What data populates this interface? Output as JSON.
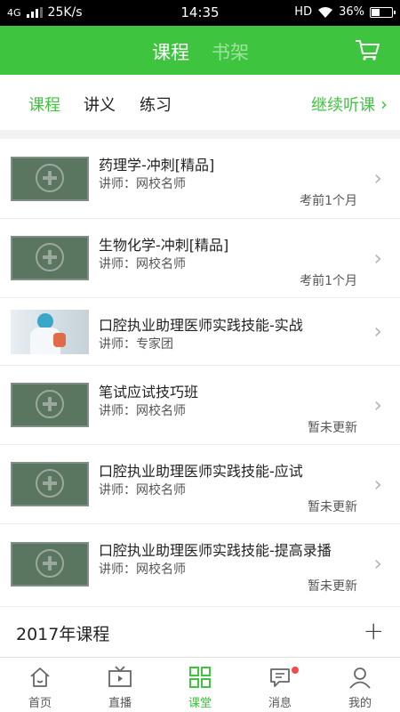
{
  "status_bar": {
    "network": "4G",
    "speed": "25K/s",
    "time": "14:35",
    "hd": "HD",
    "battery": "36%"
  },
  "header": {
    "tabs": [
      {
        "label": "课程"
      },
      {
        "label": "书架"
      }
    ]
  },
  "subtabs": {
    "items": [
      {
        "label": "课程"
      },
      {
        "label": "讲义"
      },
      {
        "label": "练习"
      }
    ],
    "continue_label": "继续听课"
  },
  "courses": [
    {
      "title": "药理学-冲刺[精品]",
      "teacher": "讲师：网校名师",
      "meta": "考前1个月",
      "thumb": "placeholder"
    },
    {
      "title": "生物化学-冲刺[精品]",
      "teacher": "讲师：网校名师",
      "meta": "考前1个月",
      "thumb": "placeholder"
    },
    {
      "title": "口腔执业助理医师实践技能-实战",
      "teacher": "讲师：专家团",
      "meta": "",
      "thumb": "photo"
    },
    {
      "title": "笔试应试技巧班",
      "teacher": "讲师：网校名师",
      "meta": "暂未更新",
      "thumb": "placeholder"
    },
    {
      "title": "口腔执业助理医师实践技能-应试",
      "teacher": "讲师：网校名师",
      "meta": "暂未更新",
      "thumb": "placeholder"
    },
    {
      "title": "口腔执业助理医师实践技能-提高录播",
      "teacher": "讲师：网校名师",
      "meta": "暂未更新",
      "thumb": "placeholder"
    }
  ],
  "section": {
    "title": "2017年课程"
  },
  "bottom_nav": [
    {
      "label": "首页",
      "icon": "home-icon"
    },
    {
      "label": "直播",
      "icon": "tv-icon"
    },
    {
      "label": "课堂",
      "icon": "grid-icon"
    },
    {
      "label": "消息",
      "icon": "message-icon"
    },
    {
      "label": "我的",
      "icon": "user-icon"
    }
  ],
  "colors": {
    "accent": "#3fc43f",
    "badge": "#f24b4b"
  }
}
